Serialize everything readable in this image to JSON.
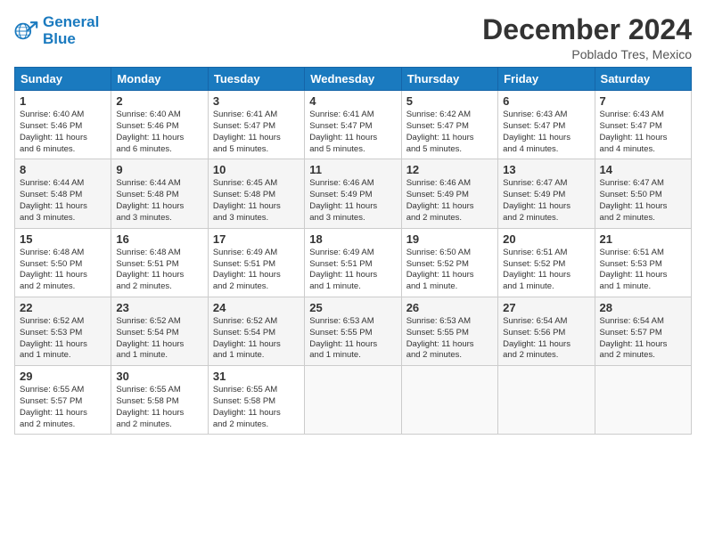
{
  "header": {
    "logo_line1": "General",
    "logo_line2": "Blue",
    "month": "December 2024",
    "location": "Poblado Tres, Mexico"
  },
  "weekdays": [
    "Sunday",
    "Monday",
    "Tuesday",
    "Wednesday",
    "Thursday",
    "Friday",
    "Saturday"
  ],
  "weeks": [
    [
      {
        "day": "1",
        "info": "Sunrise: 6:40 AM\nSunset: 5:46 PM\nDaylight: 11 hours\nand 6 minutes."
      },
      {
        "day": "2",
        "info": "Sunrise: 6:40 AM\nSunset: 5:46 PM\nDaylight: 11 hours\nand 6 minutes."
      },
      {
        "day": "3",
        "info": "Sunrise: 6:41 AM\nSunset: 5:47 PM\nDaylight: 11 hours\nand 5 minutes."
      },
      {
        "day": "4",
        "info": "Sunrise: 6:41 AM\nSunset: 5:47 PM\nDaylight: 11 hours\nand 5 minutes."
      },
      {
        "day": "5",
        "info": "Sunrise: 6:42 AM\nSunset: 5:47 PM\nDaylight: 11 hours\nand 5 minutes."
      },
      {
        "day": "6",
        "info": "Sunrise: 6:43 AM\nSunset: 5:47 PM\nDaylight: 11 hours\nand 4 minutes."
      },
      {
        "day": "7",
        "info": "Sunrise: 6:43 AM\nSunset: 5:47 PM\nDaylight: 11 hours\nand 4 minutes."
      }
    ],
    [
      {
        "day": "8",
        "info": "Sunrise: 6:44 AM\nSunset: 5:48 PM\nDaylight: 11 hours\nand 3 minutes."
      },
      {
        "day": "9",
        "info": "Sunrise: 6:44 AM\nSunset: 5:48 PM\nDaylight: 11 hours\nand 3 minutes."
      },
      {
        "day": "10",
        "info": "Sunrise: 6:45 AM\nSunset: 5:48 PM\nDaylight: 11 hours\nand 3 minutes."
      },
      {
        "day": "11",
        "info": "Sunrise: 6:46 AM\nSunset: 5:49 PM\nDaylight: 11 hours\nand 3 minutes."
      },
      {
        "day": "12",
        "info": "Sunrise: 6:46 AM\nSunset: 5:49 PM\nDaylight: 11 hours\nand 2 minutes."
      },
      {
        "day": "13",
        "info": "Sunrise: 6:47 AM\nSunset: 5:49 PM\nDaylight: 11 hours\nand 2 minutes."
      },
      {
        "day": "14",
        "info": "Sunrise: 6:47 AM\nSunset: 5:50 PM\nDaylight: 11 hours\nand 2 minutes."
      }
    ],
    [
      {
        "day": "15",
        "info": "Sunrise: 6:48 AM\nSunset: 5:50 PM\nDaylight: 11 hours\nand 2 minutes."
      },
      {
        "day": "16",
        "info": "Sunrise: 6:48 AM\nSunset: 5:51 PM\nDaylight: 11 hours\nand 2 minutes."
      },
      {
        "day": "17",
        "info": "Sunrise: 6:49 AM\nSunset: 5:51 PM\nDaylight: 11 hours\nand 2 minutes."
      },
      {
        "day": "18",
        "info": "Sunrise: 6:49 AM\nSunset: 5:51 PM\nDaylight: 11 hours\nand 1 minute."
      },
      {
        "day": "19",
        "info": "Sunrise: 6:50 AM\nSunset: 5:52 PM\nDaylight: 11 hours\nand 1 minute."
      },
      {
        "day": "20",
        "info": "Sunrise: 6:51 AM\nSunset: 5:52 PM\nDaylight: 11 hours\nand 1 minute."
      },
      {
        "day": "21",
        "info": "Sunrise: 6:51 AM\nSunset: 5:53 PM\nDaylight: 11 hours\nand 1 minute."
      }
    ],
    [
      {
        "day": "22",
        "info": "Sunrise: 6:52 AM\nSunset: 5:53 PM\nDaylight: 11 hours\nand 1 minute."
      },
      {
        "day": "23",
        "info": "Sunrise: 6:52 AM\nSunset: 5:54 PM\nDaylight: 11 hours\nand 1 minute."
      },
      {
        "day": "24",
        "info": "Sunrise: 6:52 AM\nSunset: 5:54 PM\nDaylight: 11 hours\nand 1 minute."
      },
      {
        "day": "25",
        "info": "Sunrise: 6:53 AM\nSunset: 5:55 PM\nDaylight: 11 hours\nand 1 minute."
      },
      {
        "day": "26",
        "info": "Sunrise: 6:53 AM\nSunset: 5:55 PM\nDaylight: 11 hours\nand 2 minutes."
      },
      {
        "day": "27",
        "info": "Sunrise: 6:54 AM\nSunset: 5:56 PM\nDaylight: 11 hours\nand 2 minutes."
      },
      {
        "day": "28",
        "info": "Sunrise: 6:54 AM\nSunset: 5:57 PM\nDaylight: 11 hours\nand 2 minutes."
      }
    ],
    [
      {
        "day": "29",
        "info": "Sunrise: 6:55 AM\nSunset: 5:57 PM\nDaylight: 11 hours\nand 2 minutes."
      },
      {
        "day": "30",
        "info": "Sunrise: 6:55 AM\nSunset: 5:58 PM\nDaylight: 11 hours\nand 2 minutes."
      },
      {
        "day": "31",
        "info": "Sunrise: 6:55 AM\nSunset: 5:58 PM\nDaylight: 11 hours\nand 2 minutes."
      },
      {
        "day": "",
        "info": ""
      },
      {
        "day": "",
        "info": ""
      },
      {
        "day": "",
        "info": ""
      },
      {
        "day": "",
        "info": ""
      }
    ]
  ]
}
